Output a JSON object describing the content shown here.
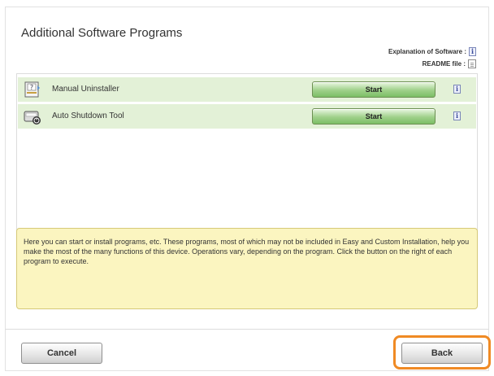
{
  "window": {
    "title": "Additional Software Programs"
  },
  "legend": {
    "explanation_label": "Explanation of Software :",
    "readme_label": "README file :"
  },
  "programs": [
    {
      "label": "Manual Uninstaller",
      "button_label": "Start",
      "icon": "uninstaller-icon"
    },
    {
      "label": "Auto Shutdown Tool",
      "button_label": "Start",
      "icon": "shutdown-tool-icon"
    }
  ],
  "info_icon_glyph": "i",
  "description": "Here you can start or install programs, etc. These programs, most of which may not be included in Easy and Custom Installation, help you make the most of the many functions of this device. Operations vary, depending on the program. Click the button on the right of each program to execute.",
  "footer": {
    "cancel_label": "Cancel",
    "back_label": "Back"
  },
  "colors": {
    "row_bg": "#e3f1d7",
    "start_button": "#9fd08a",
    "note_bg": "#fbf5c0",
    "highlight": "#f08a24"
  }
}
